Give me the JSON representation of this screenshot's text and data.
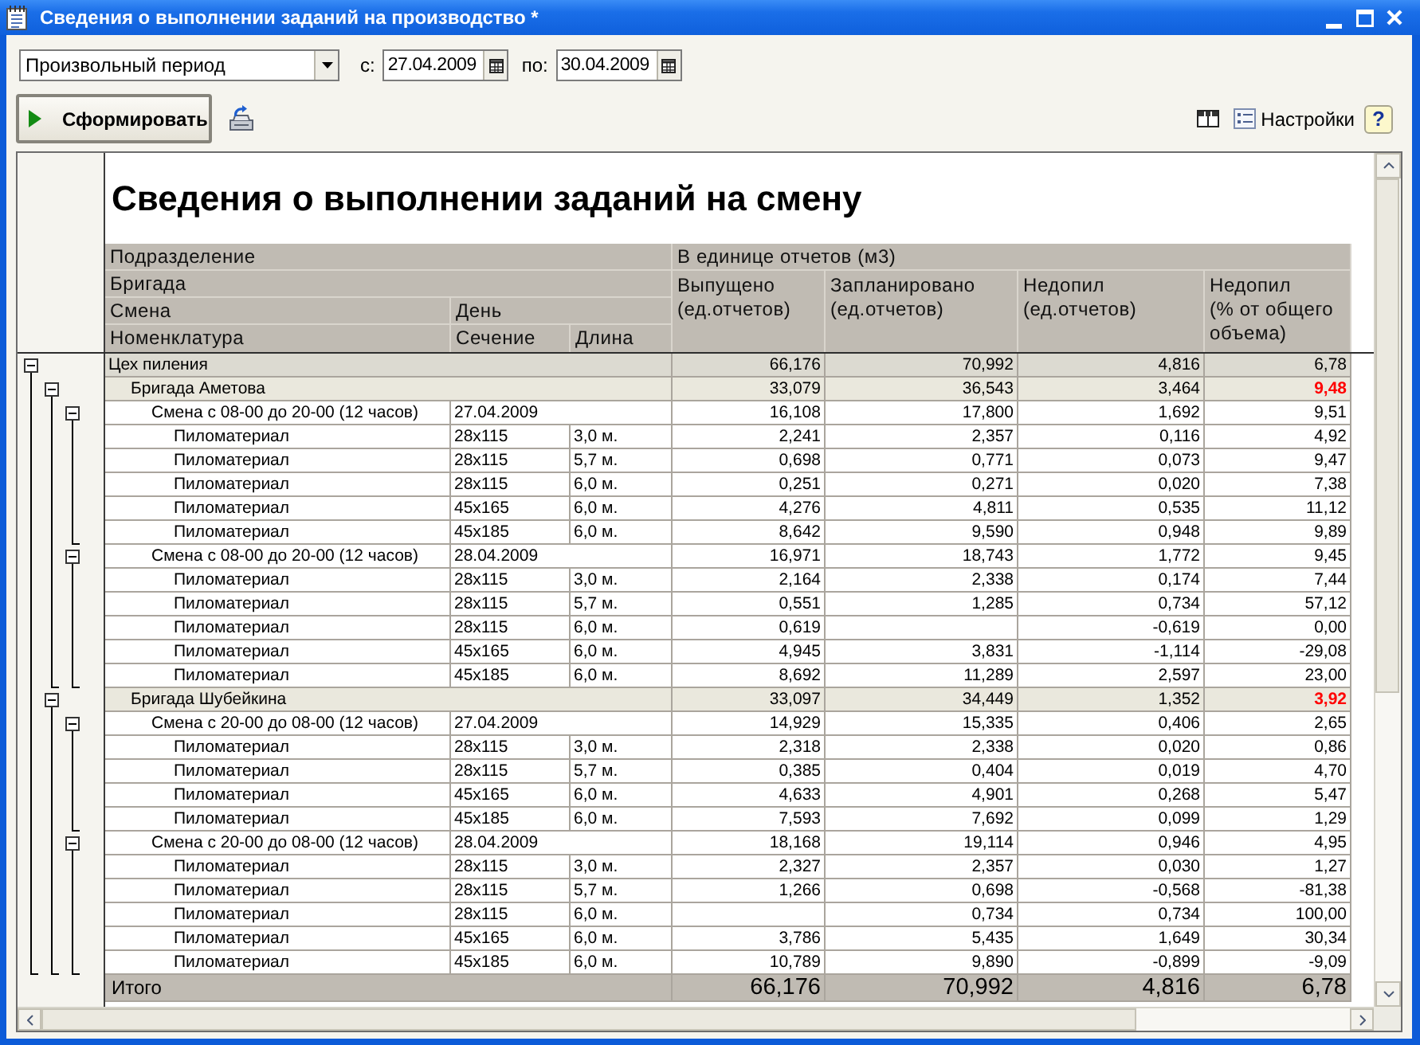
{
  "window": {
    "title": "Сведения о выполнении заданий на производство *"
  },
  "toolbar": {
    "period": "Произвольный период",
    "from_label": "с:",
    "from_date": "27.04.2009",
    "to_label": "по:",
    "to_date": "30.04.2009",
    "generate_button": "Сформировать",
    "settings_button": "Настройки",
    "help_button": "?"
  },
  "report": {
    "title": "Сведения о выполнении заданий на смену",
    "header": {
      "grouping": [
        "Подразделение",
        "Бригада",
        "Смена",
        "Номенклатура"
      ],
      "day": "День",
      "section": "Сечение",
      "length": "Длина",
      "measures_group": "В единице отчетов (м3)",
      "measures": [
        "Выпущено (ед.отчетов)",
        "Запланировано (ед.отчетов)",
        "Недопил (ед.отчетов)",
        "Недопил (% от общего объема)"
      ]
    },
    "rows": [
      {
        "kind": "department",
        "name": "Цех пиления",
        "values": {
          "issued": "66,176",
          "planned": "70,992",
          "shortfall": "4,816",
          "shortfall_percent": "6,78"
        },
        "percent_alert": false,
        "expanded": true,
        "children": [
          {
            "kind": "brigade",
            "name": "Бригада Аметова",
            "values": {
              "issued": "33,079",
              "planned": "36,543",
              "shortfall": "3,464",
              "shortfall_percent": "9,48"
            },
            "percent_alert": true,
            "expanded": true,
            "children": [
              {
                "kind": "shift",
                "name": "Смена с 08-00 до 20-00 (12 часов)",
                "day": "27.04.2009",
                "values": {
                  "issued": "16,108",
                  "planned": "17,800",
                  "shortfall": "1,692",
                  "shortfall_percent": "9,51"
                },
                "percent_alert": false,
                "expanded": true,
                "children": [
                  {
                    "kind": "item",
                    "name": "Пиломатериал",
                    "section": "28x115",
                    "length": "3,0 м.",
                    "values": {
                      "issued": "2,241",
                      "planned": "2,357",
                      "shortfall": "0,116",
                      "shortfall_percent": "4,92"
                    },
                    "percent_alert": false
                  },
                  {
                    "kind": "item",
                    "name": "Пиломатериал",
                    "section": "28x115",
                    "length": "5,7 м.",
                    "values": {
                      "issued": "0,698",
                      "planned": "0,771",
                      "shortfall": "0,073",
                      "shortfall_percent": "9,47"
                    },
                    "percent_alert": false
                  },
                  {
                    "kind": "item",
                    "name": "Пиломатериал",
                    "section": "28x115",
                    "length": "6,0 м.",
                    "values": {
                      "issued": "0,251",
                      "planned": "0,271",
                      "shortfall": "0,020",
                      "shortfall_percent": "7,38"
                    },
                    "percent_alert": false
                  },
                  {
                    "kind": "item",
                    "name": "Пиломатериал",
                    "section": "45x165",
                    "length": "6,0 м.",
                    "values": {
                      "issued": "4,276",
                      "planned": "4,811",
                      "shortfall": "0,535",
                      "shortfall_percent": "11,12"
                    },
                    "percent_alert": false
                  },
                  {
                    "kind": "item",
                    "name": "Пиломатериал",
                    "section": "45x185",
                    "length": "6,0 м.",
                    "values": {
                      "issued": "8,642",
                      "planned": "9,590",
                      "shortfall": "0,948",
                      "shortfall_percent": "9,89"
                    },
                    "percent_alert": false
                  }
                ]
              },
              {
                "kind": "shift",
                "name": "Смена с 08-00 до 20-00 (12 часов)",
                "day": "28.04.2009",
                "values": {
                  "issued": "16,971",
                  "planned": "18,743",
                  "shortfall": "1,772",
                  "shortfall_percent": "9,45"
                },
                "percent_alert": false,
                "expanded": true,
                "children": [
                  {
                    "kind": "item",
                    "name": "Пиломатериал",
                    "section": "28x115",
                    "length": "3,0 м.",
                    "values": {
                      "issued": "2,164",
                      "planned": "2,338",
                      "shortfall": "0,174",
                      "shortfall_percent": "7,44"
                    },
                    "percent_alert": false
                  },
                  {
                    "kind": "item",
                    "name": "Пиломатериал",
                    "section": "28x115",
                    "length": "5,7 м.",
                    "values": {
                      "issued": "0,551",
                      "planned": "1,285",
                      "shortfall": "0,734",
                      "shortfall_percent": "57,12"
                    },
                    "percent_alert": false
                  },
                  {
                    "kind": "item",
                    "name": "Пиломатериал",
                    "section": "28x115",
                    "length": "6,0 м.",
                    "values": {
                      "issued": "0,619",
                      "shortfall": "-0,619",
                      "shortfall_percent": "0,00"
                    },
                    "percent_alert": false
                  },
                  {
                    "kind": "item",
                    "name": "Пиломатериал",
                    "section": "45x165",
                    "length": "6,0 м.",
                    "values": {
                      "issued": "4,945",
                      "planned": "3,831",
                      "shortfall": "-1,114",
                      "shortfall_percent": "-29,08"
                    },
                    "percent_alert": false
                  },
                  {
                    "kind": "item",
                    "name": "Пиломатериал",
                    "section": "45x185",
                    "length": "6,0 м.",
                    "values": {
                      "issued": "8,692",
                      "planned": "11,289",
                      "shortfall": "2,597",
                      "shortfall_percent": "23,00"
                    },
                    "percent_alert": false
                  }
                ]
              }
            ]
          },
          {
            "kind": "brigade",
            "name": "Бригада Шубейкина",
            "values": {
              "issued": "33,097",
              "planned": "34,449",
              "shortfall": "1,352",
              "shortfall_percent": "3,92"
            },
            "percent_alert": true,
            "expanded": true,
            "children": [
              {
                "kind": "shift",
                "name": "Смена с 20-00 до 08-00 (12 часов)",
                "day": "27.04.2009",
                "values": {
                  "issued": "14,929",
                  "planned": "15,335",
                  "shortfall": "0,406",
                  "shortfall_percent": "2,65"
                },
                "percent_alert": false,
                "expanded": true,
                "children": [
                  {
                    "kind": "item",
                    "name": "Пиломатериал",
                    "section": "28x115",
                    "length": "3,0 м.",
                    "values": {
                      "issued": "2,318",
                      "planned": "2,338",
                      "shortfall": "0,020",
                      "shortfall_percent": "0,86"
                    },
                    "percent_alert": false
                  },
                  {
                    "kind": "item",
                    "name": "Пиломатериал",
                    "section": "28x115",
                    "length": "5,7 м.",
                    "values": {
                      "issued": "0,385",
                      "planned": "0,404",
                      "shortfall": "0,019",
                      "shortfall_percent": "4,70"
                    },
                    "percent_alert": false
                  },
                  {
                    "kind": "item",
                    "name": "Пиломатериал",
                    "section": "45x165",
                    "length": "6,0 м.",
                    "values": {
                      "issued": "4,633",
                      "planned": "4,901",
                      "shortfall": "0,268",
                      "shortfall_percent": "5,47"
                    },
                    "percent_alert": false
                  },
                  {
                    "kind": "item",
                    "name": "Пиломатериал",
                    "section": "45x185",
                    "length": "6,0 м.",
                    "values": {
                      "issued": "7,593",
                      "planned": "7,692",
                      "shortfall": "0,099",
                      "shortfall_percent": "1,29"
                    },
                    "percent_alert": false
                  }
                ]
              },
              {
                "kind": "shift",
                "name": "Смена с 20-00 до 08-00 (12 часов)",
                "day": "28.04.2009",
                "values": {
                  "issued": "18,168",
                  "planned": "19,114",
                  "shortfall": "0,946",
                  "shortfall_percent": "4,95"
                },
                "percent_alert": false,
                "expanded": true,
                "children": [
                  {
                    "kind": "item",
                    "name": "Пиломатериал",
                    "section": "28x115",
                    "length": "3,0 м.",
                    "values": {
                      "issued": "2,327",
                      "planned": "2,357",
                      "shortfall": "0,030",
                      "shortfall_percent": "1,27"
                    },
                    "percent_alert": false
                  },
                  {
                    "kind": "item",
                    "name": "Пиломатериал",
                    "section": "28x115",
                    "length": "5,7 м.",
                    "values": {
                      "issued": "1,266",
                      "planned": "0,698",
                      "shortfall": "-0,568",
                      "shortfall_percent": "-81,38"
                    },
                    "percent_alert": false
                  },
                  {
                    "kind": "item",
                    "name": "Пиломатериал",
                    "section": "28x115",
                    "length": "6,0 м.",
                    "values": {
                      "planned": "0,734",
                      "shortfall": "0,734",
                      "shortfall_percent": "100,00"
                    },
                    "percent_alert": false
                  },
                  {
                    "kind": "item",
                    "name": "Пиломатериал",
                    "section": "45x165",
                    "length": "6,0 м.",
                    "values": {
                      "issued": "3,786",
                      "planned": "5,435",
                      "shortfall": "1,649",
                      "shortfall_percent": "30,34"
                    },
                    "percent_alert": false
                  },
                  {
                    "kind": "item",
                    "name": "Пиломатериал",
                    "section": "45x185",
                    "length": "6,0 м.",
                    "values": {
                      "issued": "10,789",
                      "planned": "9,890",
                      "shortfall": "-0,899",
                      "shortfall_percent": "-9,09"
                    },
                    "percent_alert": false
                  }
                ]
              }
            ]
          }
        ]
      }
    ],
    "total": {
      "label": "Итого",
      "values": {
        "issued": "66,176",
        "planned": "70,992",
        "shortfall": "4,816",
        "shortfall_percent": "6,78"
      }
    }
  }
}
